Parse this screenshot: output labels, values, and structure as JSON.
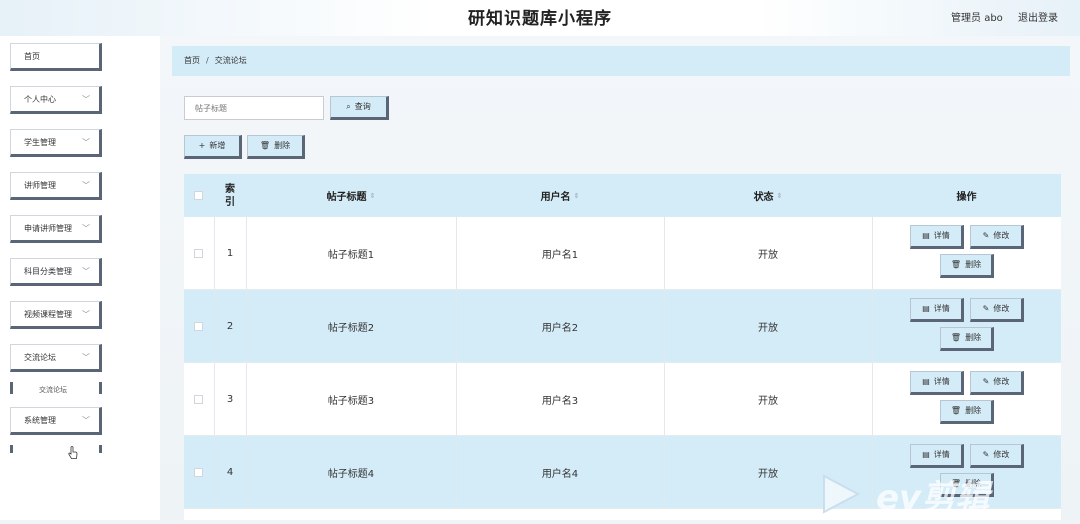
{
  "app": {
    "title": "研知识题库小程序"
  },
  "user": {
    "role_name": "管理员 abo",
    "logout": "退出登录"
  },
  "sidebar": {
    "items": [
      {
        "label": "首页",
        "has_chevron": false
      },
      {
        "label": "个人中心",
        "has_chevron": true
      },
      {
        "label": "学生管理",
        "has_chevron": true
      },
      {
        "label": "讲师管理",
        "has_chevron": true
      },
      {
        "label": "申请讲师管理",
        "has_chevron": true
      },
      {
        "label": "科目分类管理",
        "has_chevron": true
      },
      {
        "label": "视频课程管理",
        "has_chevron": true
      },
      {
        "label": "交流论坛",
        "has_chevron": true
      },
      {
        "label": "系统管理",
        "has_chevron": true
      }
    ],
    "submenu_item": "交流论坛"
  },
  "breadcrumb": {
    "home": "首页",
    "separator": "/",
    "current": "交流论坛"
  },
  "search": {
    "placeholder": "帖子标题",
    "button": "查询"
  },
  "toolbar": {
    "add": "新增",
    "delete": "删除"
  },
  "table": {
    "headers": {
      "index": "索引",
      "title": "帖子标题",
      "username": "用户名",
      "status": "状态",
      "actions": "操作"
    },
    "rows": [
      {
        "index": "1",
        "title": "帖子标题1",
        "username": "用户名1",
        "status": "开放"
      },
      {
        "index": "2",
        "title": "帖子标题2",
        "username": "用户名2",
        "status": "开放"
      },
      {
        "index": "3",
        "title": "帖子标题3",
        "username": "用户名3",
        "status": "开放"
      },
      {
        "index": "4",
        "title": "帖子标题4",
        "username": "用户名4",
        "status": "开放"
      }
    ],
    "row_actions": {
      "detail": "详情",
      "edit": "修改",
      "delete": "删除"
    }
  },
  "watermark": {
    "text": "ev剪辑"
  },
  "colors": {
    "accent": "#d4ecf7",
    "button_shadow": "#5a6578",
    "row_alt": "#d4ecf7"
  }
}
